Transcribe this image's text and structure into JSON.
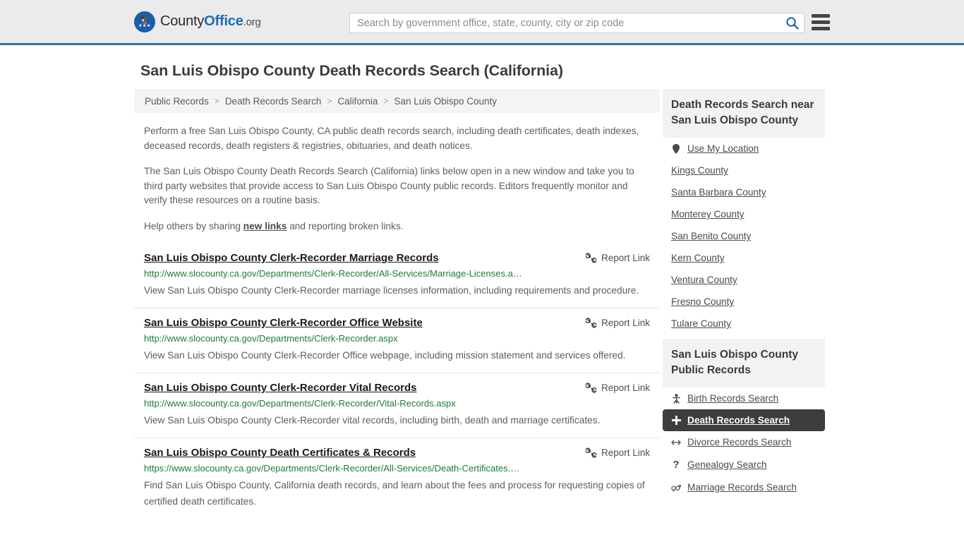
{
  "header": {
    "logo": {
      "word1": "County",
      "word2": "Office",
      "suffix": ".org",
      "icon": "eagle-seal-icon"
    },
    "search": {
      "value": "",
      "placeholder": "Search by government office, state, county, city or zip code",
      "search_icon": "search-icon"
    },
    "menu_icon": "hamburger-menu-icon",
    "accent_color": "#2e72ad",
    "background_color": "#ebebeb"
  },
  "page": {
    "title": "San Luis Obispo County Death Records Search (California)"
  },
  "breadcrumb": {
    "separator": ">",
    "items": [
      {
        "label": "Public Records"
      },
      {
        "label": "Death Records Search"
      },
      {
        "label": "California"
      },
      {
        "label": "San Luis Obispo County"
      }
    ]
  },
  "intro": {
    "paragraph1": "Perform a free San Luis Obispo County, CA public death records search, including death certificates, death indexes, deceased records, death registers & registries, obituaries, and death notices.",
    "paragraph2": "The San Luis Obispo County Death Records Search (California) links below open in a new window and take you to third party websites that provide access to San Luis Obispo County public records. Editors frequently monitor and verify these resources on a routine basis.",
    "paragraph3_before": "Help others by sharing ",
    "paragraph3_link": "new links",
    "paragraph3_after": " and reporting broken links."
  },
  "results": {
    "report_label": "Report Link",
    "report_icon": "broken-link-icon",
    "url_color": "#1a7f2e",
    "items": [
      {
        "title": "San Luis Obispo County Clerk-Recorder Marriage Records",
        "url": "http://www.slocounty.ca.gov/Departments/Clerk-Recorder/All-Services/Marriage-Licenses.a…",
        "description": "View San Luis Obispo County Clerk-Recorder marriage licenses information, including requirements and procedure."
      },
      {
        "title": "San Luis Obispo County Clerk-Recorder Office Website",
        "url": "http://www.slocounty.ca.gov/Departments/Clerk-Recorder.aspx",
        "description": "View San Luis Obispo County Clerk-Recorder Office webpage, including mission statement and services offered."
      },
      {
        "title": "San Luis Obispo County Clerk-Recorder Vital Records",
        "url": "http://www.slocounty.ca.gov/Departments/Clerk-Recorder/Vital-Records.aspx",
        "description": "View San Luis Obispo County Clerk-Recorder vital records, including birth, death and marriage certificates."
      },
      {
        "title": "San Luis Obispo County Death Certificates & Records",
        "url": "https://www.slocounty.ca.gov/Departments/Clerk-Recorder/All-Services/Death-Certificates.…",
        "description": "Find San Luis Obispo County, California death records, and learn about the fees and process for requesting copies of certified death certificates."
      }
    ]
  },
  "sidebar": {
    "nearby": {
      "heading": "Death Records Search near San Luis Obispo County",
      "items": [
        {
          "label": "Use My Location",
          "icon": "map-pin-icon"
        },
        {
          "label": "Kings County",
          "icon": ""
        },
        {
          "label": "Santa Barbara County",
          "icon": ""
        },
        {
          "label": "Monterey County",
          "icon": ""
        },
        {
          "label": "San Benito County",
          "icon": ""
        },
        {
          "label": "Kern County",
          "icon": ""
        },
        {
          "label": "Ventura County",
          "icon": ""
        },
        {
          "label": "Fresno County",
          "icon": ""
        },
        {
          "label": "Tulare County",
          "icon": ""
        }
      ]
    },
    "public_records": {
      "heading": "San Luis Obispo County Public Records",
      "active_highlight_color": "#3d3d3d",
      "items": [
        {
          "label": "Birth Records Search",
          "icon": "baby-icon",
          "glyph": "Ɣ",
          "active": false
        },
        {
          "label": "Death Records Search",
          "icon": "cross-icon",
          "glyph": "✚",
          "active": true
        },
        {
          "label": "Divorce Records Search",
          "icon": "split-arrows-icon",
          "glyph": "↔",
          "active": false
        },
        {
          "label": "Genealogy Search",
          "icon": "question-mark-icon",
          "glyph": "?",
          "active": false
        },
        {
          "label": "Marriage Records Search",
          "icon": "gender-symbols-icon",
          "glyph": "⚥",
          "active": false
        }
      ]
    }
  }
}
